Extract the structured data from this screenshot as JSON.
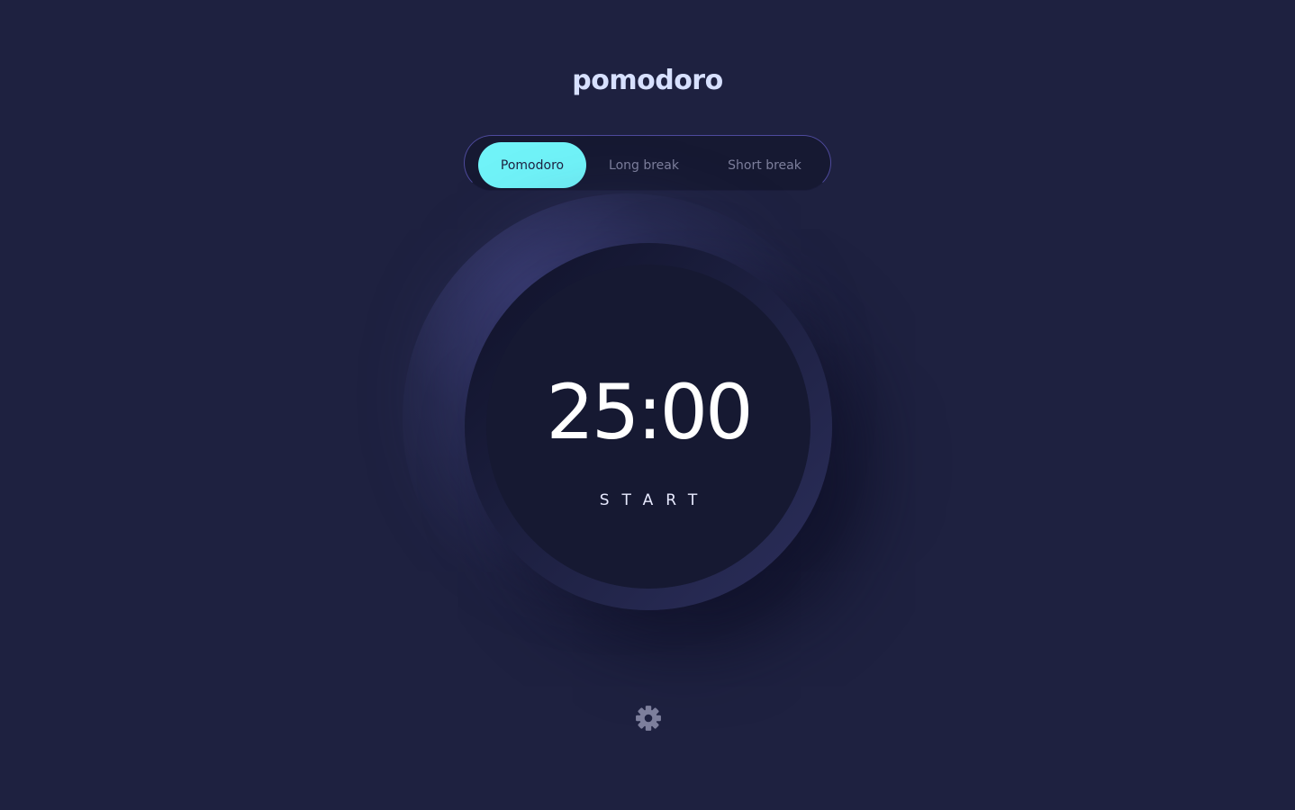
{
  "app": {
    "title": "pomodoro"
  },
  "modes": {
    "selected": "Pomodoro",
    "tabs": [
      {
        "label": "Pomodoro",
        "active": true
      },
      {
        "label": "Long break",
        "active": false
      },
      {
        "label": "Short break",
        "active": false
      }
    ]
  },
  "timer": {
    "display": "25:00",
    "action_label": "START"
  },
  "settings": {
    "icon": "gear-icon"
  },
  "colors": {
    "background": "#1e2140",
    "panel": "#161932",
    "accent": "#70f3f8",
    "title_text": "#d7e0ff",
    "inactive_text": "#7d7f9c",
    "icon": "#7d7f9c"
  }
}
